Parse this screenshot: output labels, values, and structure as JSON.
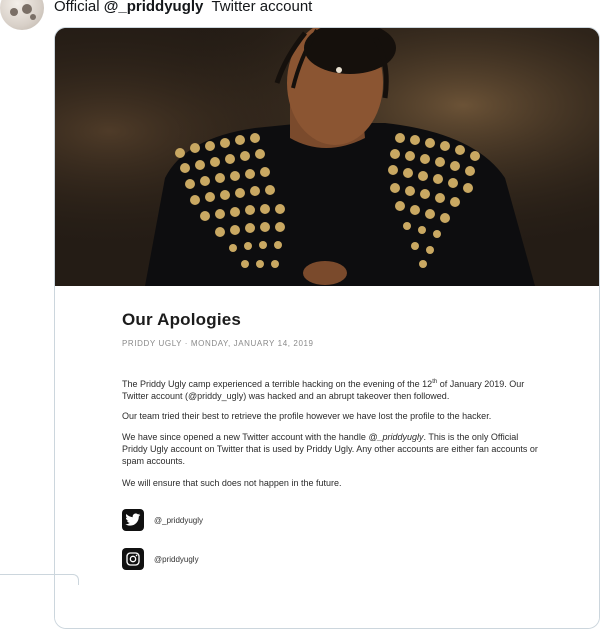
{
  "tweet": {
    "text_prefix": "Official ",
    "handle": "@_priddyugly",
    "text_suffix": "  Twitter account"
  },
  "article": {
    "title": "Our Apologies",
    "meta": "PRIDDY UGLY · MONDAY, JANUARY 14, 2019",
    "para1_a": "The Priddy Ugly camp experienced a terrible hacking on the evening of the 12",
    "para1_sup": "th",
    "para1_b": " of January 2019. Our Twitter account (@priddy_ugly) was hacked and an abrupt takeover then followed.",
    "para2": "Our team tried their best to retrieve the profile however we have lost the profile to the hacker.",
    "para3_a": "We have since opened a new Twitter account with the handle ",
    "para3_handle": "@_priddyugly",
    "para3_b": ". This is the only Official Priddy Ugly account on Twitter that is used by Priddy Ugly. Any other accounts are either fan accounts or spam accounts.",
    "para4": "We will ensure that such does not happen in the future."
  },
  "social": [
    {
      "icon": "twitter-icon",
      "label": "@_priddyugly"
    },
    {
      "icon": "instagram-icon",
      "label": "@priddyugly"
    }
  ]
}
